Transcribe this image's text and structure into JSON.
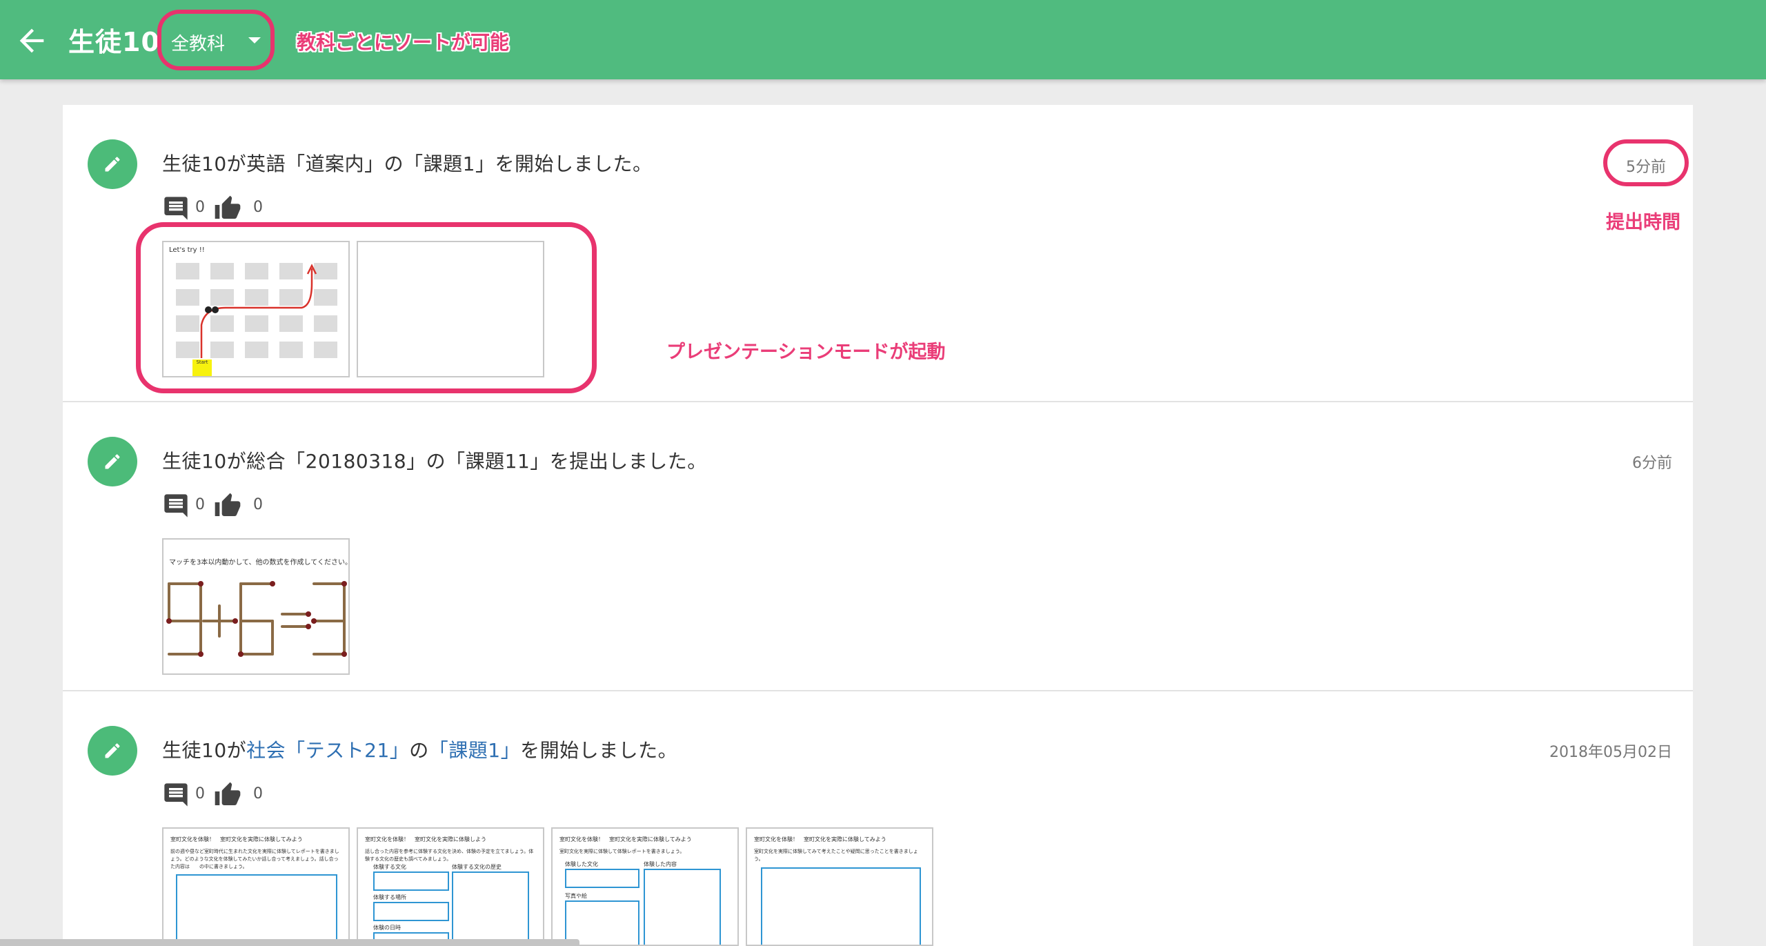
{
  "header": {
    "title": "生徒10",
    "subject_filter": "全教科",
    "bg_color": "#50bb7f"
  },
  "annotations": {
    "sort": "教科ごとにソートが可能",
    "submit_time": "提出時間",
    "presentation": "プレゼンテーションモードが起動",
    "highlight_color": "#e8336d"
  },
  "feed": [
    {
      "message": "生徒10が英語「道案内」の「課題1」を開始しました。",
      "time": "5分前",
      "comments": "0",
      "likes": "0",
      "thumb1_title": "Let's try !!",
      "thumb1_start": "Start"
    },
    {
      "message": "生徒10が総合「20180318」の「課題11」を提出しました。",
      "time": "6分前",
      "comments": "0",
      "likes": "0",
      "thumb_title": "マッチを3本以内動かして、他の数式を作成してください。",
      "equation": "9+6=3"
    },
    {
      "message_prefix": "生徒10が",
      "subject_link": "社会「テスト21」",
      "message_mid": "の",
      "task_link": "「課題1」",
      "message_suffix": "を開始しました。",
      "time": "2018年05月02日",
      "comments": "0",
      "likes": "0",
      "worksheets": [
        {
          "title": "室町文化を体験！　室町文化を実際に体験してみよう",
          "text": "前の週や昼など室町時代に生まれた文化を実際に体験してレポートを書きましょう。どのような文化を体験してみたいか話し合って考えましょう。話し合った内容は　　の中に書きましょう。"
        },
        {
          "title": "室町文化を体験！　室町文化を実際に体験しよう",
          "text": "話し合った内容を参考に体験する文化を決め、体験の予定を立てましょう。体験する文化の歴史も調べてみましょう。",
          "labels": [
            "体験する文化",
            "体験する文化の歴史",
            "体験する場所",
            "体験の日時"
          ]
        },
        {
          "title": "室町文化を体験！　室町文化を実際に体験してみよう",
          "text": "室町文化を実際に体験して体験レポートを書きましょう。",
          "labels": [
            "体験した文化",
            "体験した内容",
            "写真や絵"
          ]
        },
        {
          "title": "室町文化を体験！　室町文化を実際に体験してみよう",
          "text": "室町文化を実際に体験してみて考えたことや疑問に思ったことを書きましょう。"
        }
      ]
    }
  ]
}
